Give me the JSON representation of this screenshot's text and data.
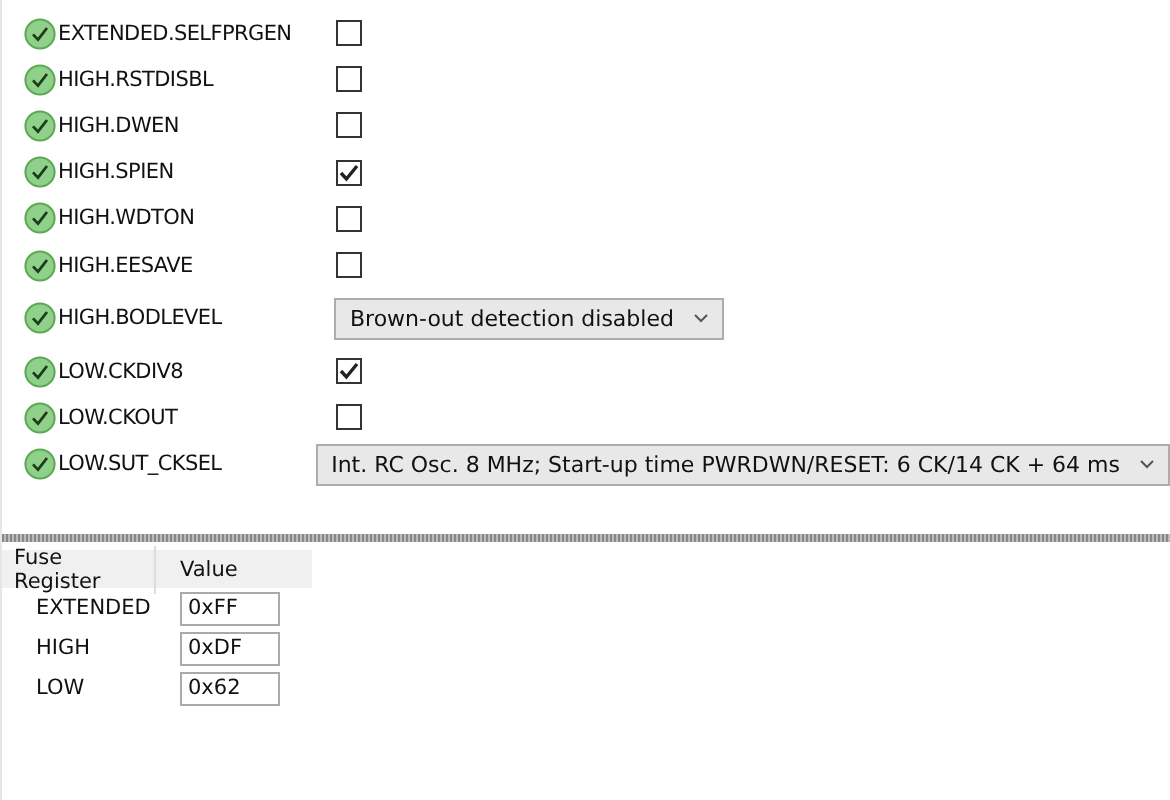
{
  "fuses": [
    {
      "name": "EXTENDED.SELFPRGEN",
      "kind": "checkbox",
      "checked": false
    },
    {
      "name": "HIGH.RSTDISBL",
      "kind": "checkbox",
      "checked": false
    },
    {
      "name": "HIGH.DWEN",
      "kind": "checkbox",
      "checked": false
    },
    {
      "name": "HIGH.SPIEN",
      "kind": "checkbox",
      "checked": true
    },
    {
      "name": "HIGH.WDTON",
      "kind": "checkbox",
      "checked": false
    },
    {
      "name": "HIGH.EESAVE",
      "kind": "checkbox",
      "checked": false
    },
    {
      "name": "HIGH.BODLEVEL",
      "kind": "dropdown",
      "value": "Brown-out detection disabled"
    },
    {
      "name": "LOW.CKDIV8",
      "kind": "checkbox",
      "checked": true
    },
    {
      "name": "LOW.CKOUT",
      "kind": "checkbox",
      "checked": false
    },
    {
      "name": "LOW.SUT_CKSEL",
      "kind": "dropdown",
      "value": "Int. RC Osc. 8 MHz; Start-up time PWRDWN/RESET: 6 CK/14 CK + 64 ms"
    }
  ],
  "registers": {
    "columns": [
      "Fuse Register",
      "Value"
    ],
    "rows": [
      {
        "name": "EXTENDED",
        "value": "0xFF"
      },
      {
        "name": "HIGH",
        "value": "0xDF"
      },
      {
        "name": "LOW",
        "value": "0x62"
      }
    ]
  }
}
